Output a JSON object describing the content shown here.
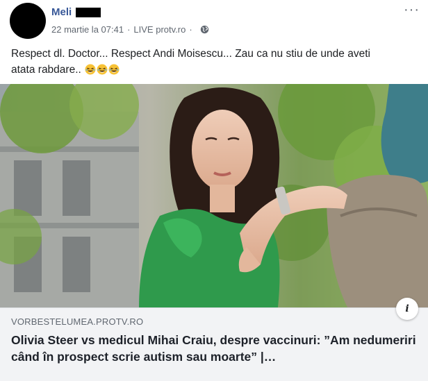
{
  "post": {
    "author": "Meli",
    "timestamp": "22 martie la 07:41",
    "separator": "·",
    "source": "LIVE protv.ro",
    "more_icon": "more-horizontal-icon",
    "privacy_icon": "globe-icon",
    "text_line1": "Respect dl. Doctor... Respect Andi Moisescu... Zau ca nu stiu de unde aveti",
    "text_line2": "atata rabdare..",
    "emoji_icon": "rofl-emoji-icon",
    "emoji_count": 3
  },
  "link_preview": {
    "domain": "VORBESTELUMEA.PROTV.RO",
    "title": "Olivia Steer vs medicul Mihai Craiu, despre vaccinuri: ”Am nedumeriri când în prospect scrie autism sau moarte” |…",
    "info_icon": "info-icon",
    "info_label": "i"
  },
  "colors": {
    "author": "#385898",
    "link_bg": "#f2f3f5",
    "meta": "#606770"
  }
}
